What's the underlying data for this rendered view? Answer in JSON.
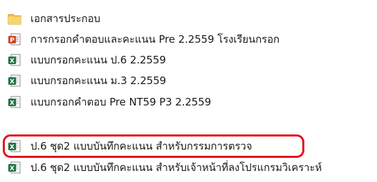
{
  "files": [
    {
      "name": "เอกสารประกอบ",
      "type": "folder",
      "icon": "folder-icon"
    },
    {
      "name": "การกรอกคำตอบและคะแนน Pre 2.2559 โรงเรียนกรอก",
      "type": "powerpoint",
      "icon": "powerpoint-file-icon"
    },
    {
      "name": "แบบกรอกคะแนน ป.6 2.2559",
      "type": "excel",
      "icon": "excel-file-icon"
    },
    {
      "name": "แบบกรอกคะแนน ม.3 2.2559",
      "type": "excel",
      "icon": "excel-file-icon"
    },
    {
      "name": "แบบกรอกคำตอบ Pre NT59 P3 2.2559",
      "type": "excel",
      "icon": "excel-file-icon"
    },
    {
      "name": "ป.6 ชุด2 แบบบันทึกคะแนน สำหรับกรรมการตรวจ",
      "type": "excel",
      "icon": "excel-file-icon",
      "highlighted": true
    },
    {
      "name": "ป.6 ชุด2 แบบบันทึกคะแนน สำหรับเจ้าหน้าที่ลงโปรแกรมวิเคราะห์",
      "type": "excel",
      "icon": "excel-file-icon"
    }
  ],
  "colors": {
    "highlight": "#e3101b",
    "folder": "#f4c542",
    "powerpoint": "#d24726",
    "excel": "#1e7145"
  }
}
